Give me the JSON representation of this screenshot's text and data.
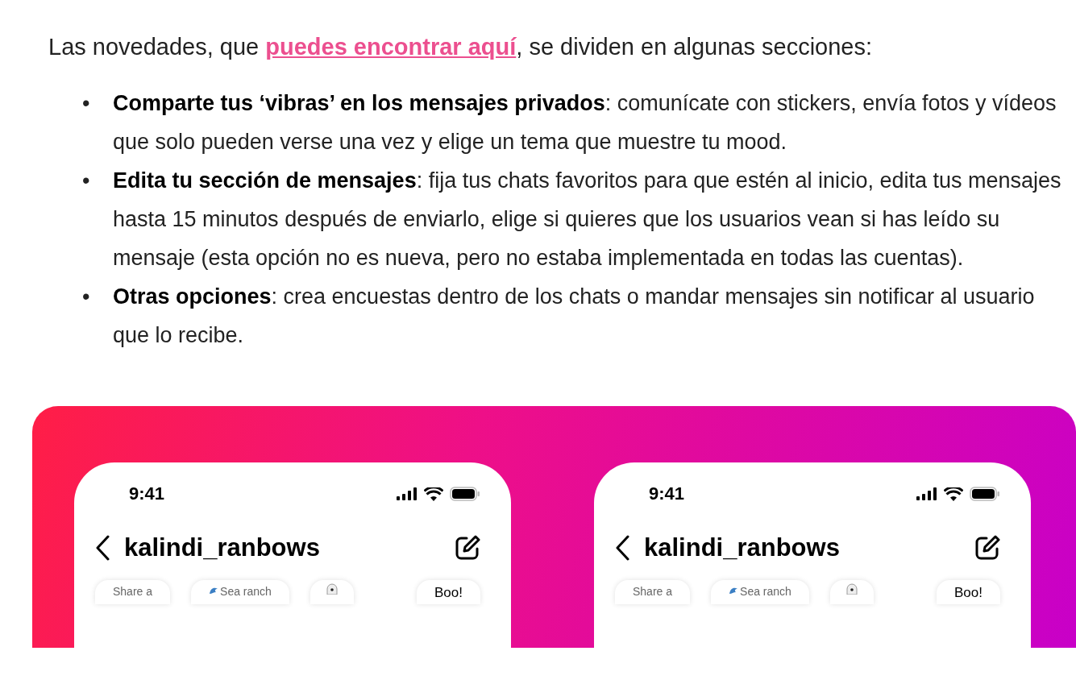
{
  "intro": {
    "before": "Las novedades, que ",
    "link": "puedes encontrar aquí",
    "after": ", se dividen en algunas secciones:"
  },
  "bullets": [
    {
      "marker": "•",
      "text": "**Comparte tus ‘vibras’ en los mensajes privados**: comunícate con stickers, envía fotos y vídeos que solo pueden verse una vez y elige un tema que muestre tu mood."
    },
    {
      "marker": "•",
      "text": "**Edita tu sección de mensajes**: fija tus chats favoritos para que estén al inicio, edita tus mensajes hasta 15 minutos después de enviarlo, elige si quieres que los usuarios vean si has leído su mensaje (esta opción no es nueva, pero no estaba implementada en todas las cuentas)."
    },
    {
      "marker": "•",
      "text": "**Otras opciones**: crea encuestas dentro de los chats o mandar mensajes sin notificar al usuario que lo recibe."
    }
  ],
  "phones": [
    {
      "time": "9:41",
      "username": "kalindi_ranbows",
      "chips": [
        {
          "kind": "text",
          "label": "Share a"
        },
        {
          "kind": "emoji",
          "label": "Sea ranch"
        },
        {
          "kind": "icon"
        },
        {
          "kind": "text",
          "label": "Boo!"
        }
      ]
    },
    {
      "time": "9:41",
      "username": "kalindi_ranbows",
      "chips": [
        {
          "kind": "text",
          "label": "Share a"
        },
        {
          "kind": "emoji",
          "label": "Sea ranch"
        },
        {
          "kind": "icon"
        },
        {
          "kind": "text",
          "label": "Boo!"
        }
      ]
    }
  ]
}
